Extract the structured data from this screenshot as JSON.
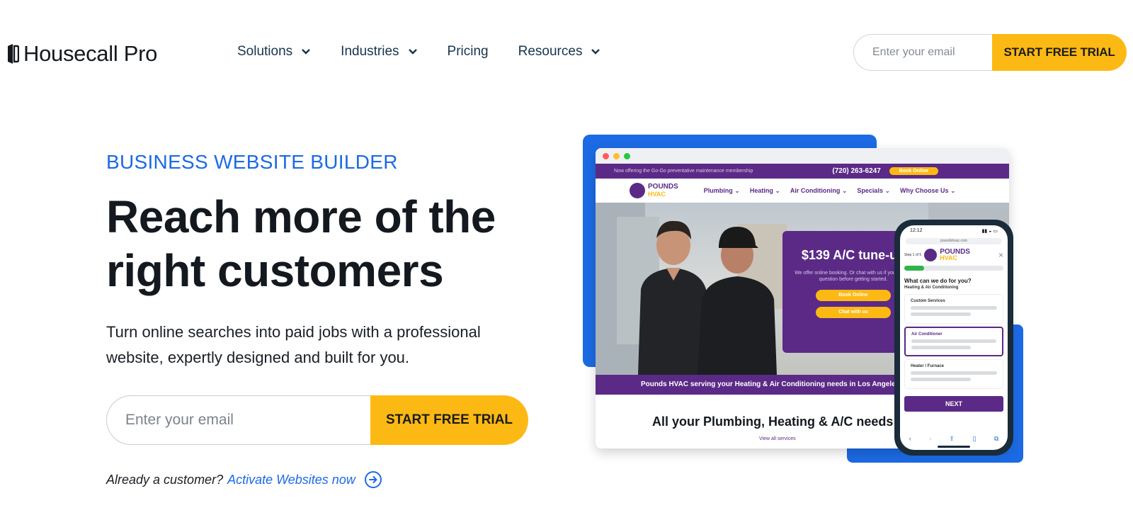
{
  "nav": {
    "logo_text": "Housecall Pro",
    "items": [
      {
        "label": "Solutions",
        "dropdown": true
      },
      {
        "label": "Industries",
        "dropdown": true
      },
      {
        "label": "Pricing",
        "dropdown": false
      },
      {
        "label": "Resources",
        "dropdown": true
      }
    ],
    "email_placeholder": "Enter your email",
    "cta_label": "START FREE TRIAL"
  },
  "hero": {
    "eyebrow": "BUSINESS WEBSITE BUILDER",
    "headline": "Reach more of the right customers",
    "subhead": "Turn online searches into paid jobs with a professional website, expertly designed and built for you.",
    "email_placeholder": "Enter your email",
    "cta_label": "START FREE TRIAL",
    "already_customer": "Already a customer?",
    "activate_link": "Activate Websites now"
  },
  "mockup": {
    "topbar_text": "Now offering the Go-Go preventative maintenance membership",
    "phone_number": "(720) 263-6247",
    "book_online": "Book Online",
    "brand_line1": "POUNDS",
    "brand_line2": "HVAC",
    "site_nav": [
      "Plumbing ⌄",
      "Heating ⌄",
      "Air Conditioning ⌄",
      "Specials ⌄",
      "Why Choose Us ⌄"
    ],
    "promo_title": "$139 A/C tune-up",
    "promo_desc": "We offer online booking. Or chat with us if you have a question before getting started.",
    "promo_btn1": "Book Online",
    "promo_btn2": "Chat with us",
    "strip_text": "Pounds HVAC serving your Heating & Air Conditioning needs in Los Angeles since",
    "section_title": "All your Plumbing, Heating & A/C needs",
    "view_all": "View all services",
    "phone": {
      "time": "12:12",
      "url": "poundshvac.com",
      "step": "Step 1 of 5",
      "question": "What can we do for you?",
      "subtitle": "Heating & Air Conditioning",
      "options": [
        "Custom Services",
        "Air Conditioner",
        "Heater / Furnace"
      ],
      "selected_option": "Air Conditioner",
      "next_label": "NEXT",
      "progress": 0.2
    }
  },
  "colors": {
    "brand_blue": "#1c6ae4",
    "cta_yellow": "#fdb913",
    "hvac_purple": "#5b2a86"
  }
}
